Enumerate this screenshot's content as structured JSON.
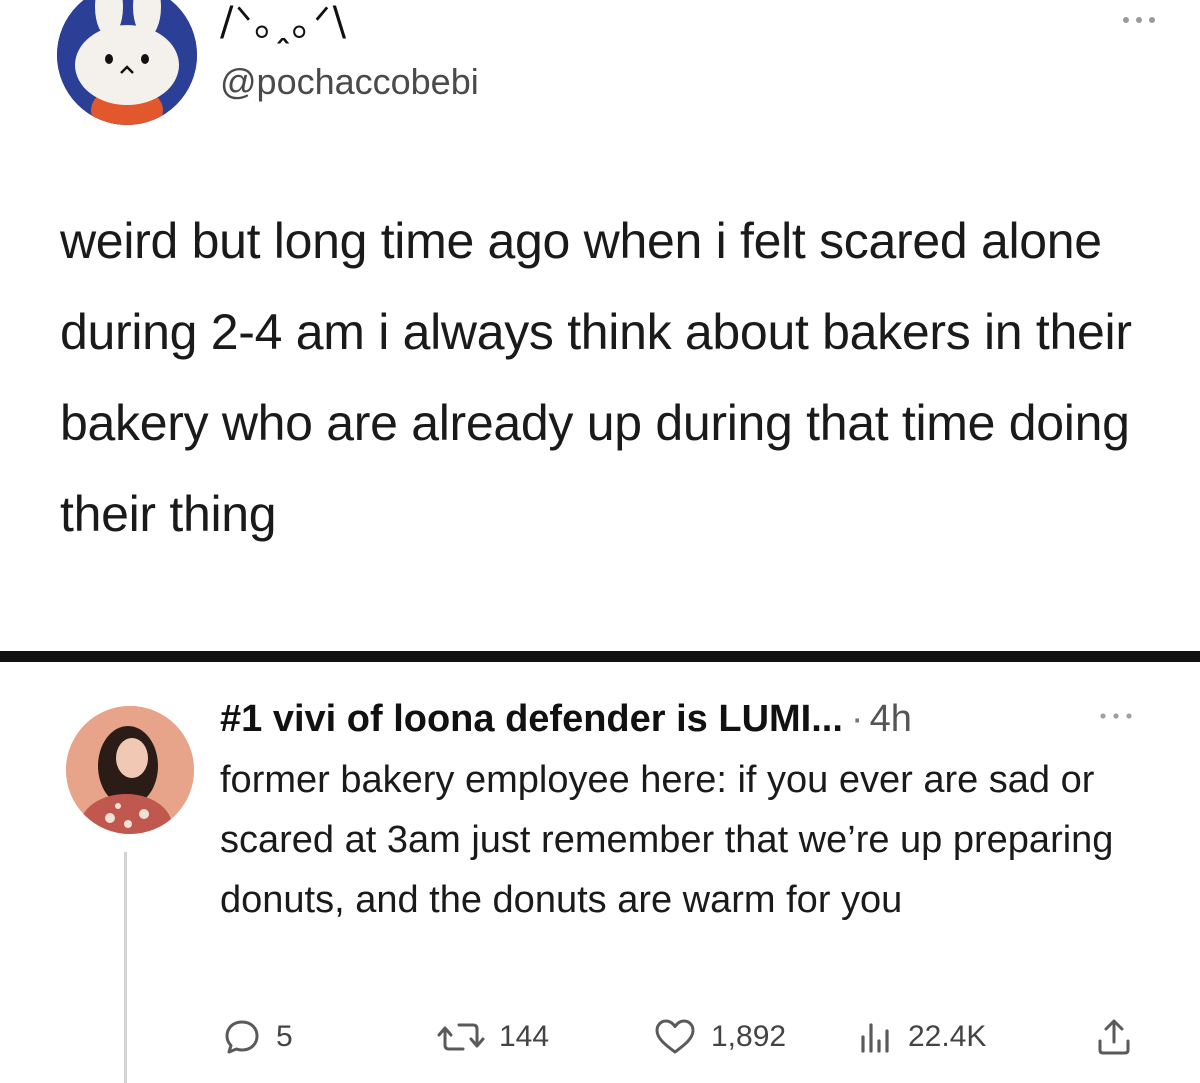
{
  "top_post": {
    "display_name": "/ᐠ｡ꞈ｡ᐟ\\",
    "handle": "@pochaccobebi",
    "body": "weird but long time ago when i felt scared alone during 2-4 am i always think about bakers in their bakery who are already up during that time doing their thing"
  },
  "reply_post": {
    "display_name": "#1 vivi of loona defender is LUMI...",
    "separator": "·",
    "time": "4h",
    "body": "former bakery employee here: if you ever are sad or scared at 3am just remember that we’re up preparing donuts, and the donuts are warm for you",
    "actions": {
      "replies": "5",
      "reposts": "144",
      "likes": "1,892",
      "views": "22.4K"
    }
  },
  "icons": {
    "top_more": "more-horizontal-icon",
    "reply_more": "more-horizontal-icon",
    "reply": "comment-bubble-icon",
    "repost": "repost-arrows-icon",
    "like": "heart-icon",
    "views": "bar-chart-icon",
    "share": "share-upload-icon"
  },
  "colors": {
    "text": "#111111",
    "secondary_text": "#555555",
    "icon": "#5a5a5a",
    "divider": "#111111",
    "thread_line": "#d3d3d3",
    "top_avatar_bg": "#2b3f96",
    "reply_avatar_bg": "#e8a48b"
  }
}
